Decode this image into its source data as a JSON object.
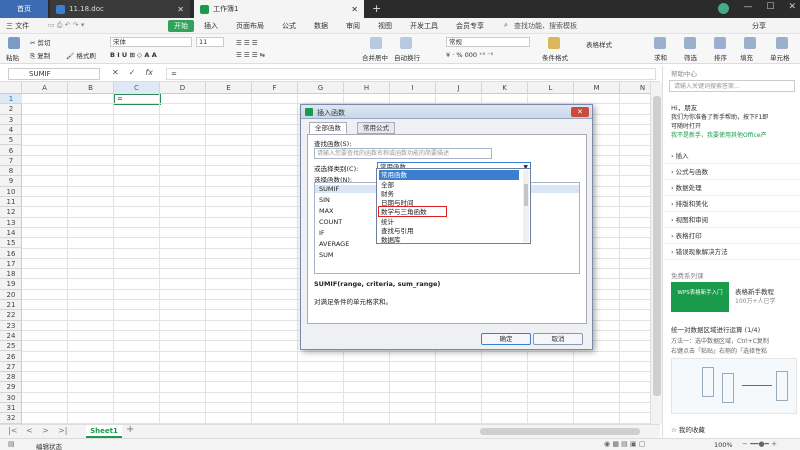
{
  "tabs": {
    "home": "首页",
    "doc": "11.18.doc",
    "active": "工作簿1",
    "new": "+"
  },
  "menu": {
    "file": "三 文件",
    "start": "开始",
    "items": [
      "插入",
      "页面布局",
      "公式",
      "数据",
      "审阅",
      "视图",
      "开发工具",
      "会员专享"
    ],
    "search": "查找功能、搜索模板",
    "share": "分享"
  },
  "ribbon": {
    "cut": "剪切",
    "copy": "复制",
    "format_painter": "格式刷",
    "paste": "粘贴",
    "font_name": "宋体",
    "font_size": "11",
    "merge_center": "合并居中",
    "wrap_text": "自动换行",
    "number_format": "常规",
    "cond_format": "条件格式",
    "table_style": "表格样式",
    "sum": "求和",
    "filter": "筛选",
    "sort": "排序",
    "fill": "填充",
    "cell": "单元格"
  },
  "formula_bar": {
    "name": "SUMIF",
    "value": "="
  },
  "grid": {
    "columns": [
      "A",
      "B",
      "C",
      "D",
      "E",
      "F",
      "G",
      "H",
      "I",
      "J",
      "K",
      "L",
      "M",
      "N"
    ],
    "rows": [
      "1",
      "2",
      "3",
      "4",
      "5",
      "6",
      "7",
      "8",
      "9",
      "10",
      "11",
      "12",
      "13",
      "14",
      "15",
      "16",
      "17",
      "18",
      "19",
      "20",
      "21",
      "22",
      "23",
      "24",
      "25",
      "26",
      "27",
      "28",
      "29",
      "30",
      "31",
      "32"
    ],
    "active_cell_value": "="
  },
  "sheet": {
    "tab": "Sheet1",
    "status": "编辑状态",
    "zoom": "100%"
  },
  "dialog": {
    "title": "插入函数",
    "tab_all": "全部函数",
    "tab_common": "常用公式",
    "search_label": "查找函数(S):",
    "search_placeholder": "请输入您要查找的函数名称或函数功能的简要描述",
    "category_label": "或选择类别(C):",
    "category_value": "常用函数",
    "select_label": "选择函数(N):",
    "functions": [
      "SUMIF",
      "SIN",
      "MAX",
      "COUNT",
      "IF",
      "AVERAGE",
      "SUM"
    ],
    "categories": [
      "常用函数",
      "全部",
      "财务",
      "日期与时间",
      "数学与三角函数",
      "统计",
      "查找与引用",
      "数据库"
    ],
    "signature": "SUMIF(range, criteria, sum_range)",
    "description": "对满足条件的单元格求和。",
    "ok": "确定",
    "cancel": "取消"
  },
  "panel": {
    "header": "帮助中心",
    "search_placeholder": "请输入关键词搜索答案...",
    "greeting": "Hi，朋友",
    "intro1": "我们为你准备了新手帮助，按下F1即",
    "intro2": "可随时打开",
    "link": "我不是新手，我要使用其他Office产",
    "sections": [
      "插入",
      "公式与函数",
      "数据处理",
      "排版和美化",
      "视图和审阅",
      "表格打印",
      "错误现象解决方法"
    ],
    "free_course": "免费系列课",
    "course_thumb": "WPS表格新手入门",
    "course_title": "表格新手教程",
    "course_count": "100万+人已学",
    "tip_title": "统一对数据区域进行运算 (1/4)",
    "tip_text1": "方法一：选中数据区域，Ctrl+C复制",
    "tip_text2": "右键点击「粘贴」右侧的「选择性粘",
    "favorites": "我的收藏"
  },
  "colors": {
    "accent_green": "#1a9b4b",
    "titlebar": "#2b2b2b",
    "highlight_red": "#e02020",
    "selection_blue": "#3c7fd0"
  }
}
